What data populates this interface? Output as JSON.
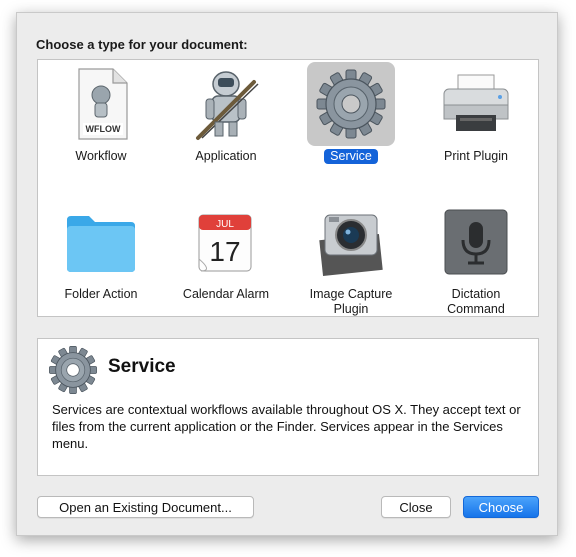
{
  "dialog": {
    "heading": "Choose a type for your document:",
    "types": [
      {
        "label": "Workflow",
        "icon": "workflow-file-icon",
        "doc_label": "WFLOW"
      },
      {
        "label": "Application",
        "icon": "automator-robot-icon"
      },
      {
        "label": "Service",
        "icon": "gear-icon",
        "selected": true
      },
      {
        "label": "Print Plugin",
        "icon": "printer-icon"
      },
      {
        "label": "Folder Action",
        "icon": "folder-icon"
      },
      {
        "label": "Calendar Alarm",
        "icon": "calendar-icon",
        "month": "JUL",
        "day": "17"
      },
      {
        "label": "Image Capture\nPlugin",
        "icon": "camera-icon"
      },
      {
        "label": "Dictation\nCommand",
        "icon": "microphone-icon"
      }
    ],
    "description": {
      "title": "Service",
      "text": "Services are contextual workflows available throughout OS X. They accept text or files from the current application or the Finder. Services appear in the Services menu."
    },
    "buttons": {
      "open_existing": "Open an Existing Document...",
      "close": "Close",
      "choose": "Choose"
    }
  },
  "colors": {
    "accent": "#1463d9",
    "dialog_bg": "#ececec"
  }
}
